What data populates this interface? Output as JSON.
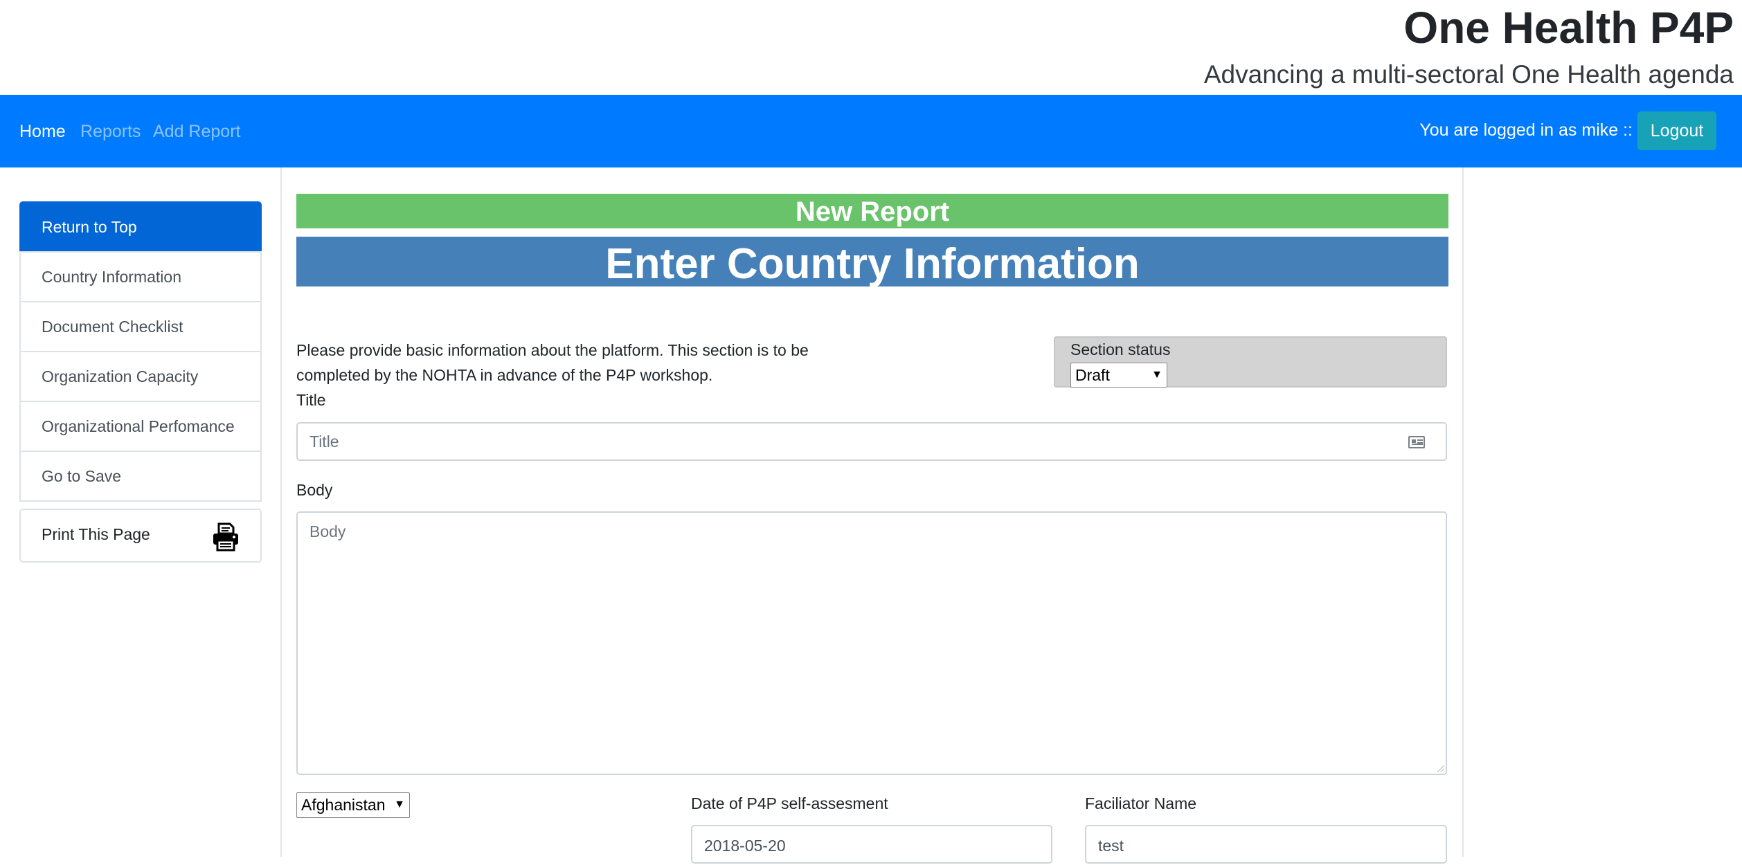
{
  "brand": {
    "title": "One Health P4P",
    "subtitle": "Advancing a multi-sectoral One Health agenda"
  },
  "nav": {
    "items": [
      {
        "label": "Home",
        "active": true
      },
      {
        "label": "Reports",
        "active": false
      },
      {
        "label": "Add Report",
        "active": false
      }
    ],
    "login_text": "You are logged in as mike ::",
    "logout_label": "Logout"
  },
  "sidebar": {
    "items": [
      {
        "label": "Return to Top",
        "active": true
      },
      {
        "label": "Country Information"
      },
      {
        "label": "Document Checklist"
      },
      {
        "label": "Organization Capacity"
      },
      {
        "label": "Organizational Perfomance"
      },
      {
        "label": "Go to Save"
      }
    ],
    "print_label": "Print This Page",
    "print_icon": "printer-icon"
  },
  "main": {
    "banner": "New Report",
    "section_title": "Enter Country Information",
    "intro": "Please provide basic information about the platform. This section is to be completed by the NOHTA in advance of the P4P workshop.",
    "section_status": {
      "label": "Section status",
      "value": "Draft"
    },
    "title_field": {
      "label": "Title",
      "placeholder": "Title",
      "icon": "id-card-icon"
    },
    "body_field": {
      "label": "Body",
      "placeholder": "Body"
    },
    "country": {
      "value": "Afghanistan"
    },
    "date_field": {
      "label": "Date of P4P self-assesment",
      "value": "2018-05-20"
    },
    "facilitator_field": {
      "label": "Faciliator Name",
      "value": "test"
    }
  },
  "colors": {
    "navbar": "#007bff",
    "logout": "#17a2b8",
    "sidebar_active": "#0366d6",
    "banner_green": "#69c36a",
    "banner_blue": "#4581b8",
    "status_box": "#d3d3d3"
  }
}
